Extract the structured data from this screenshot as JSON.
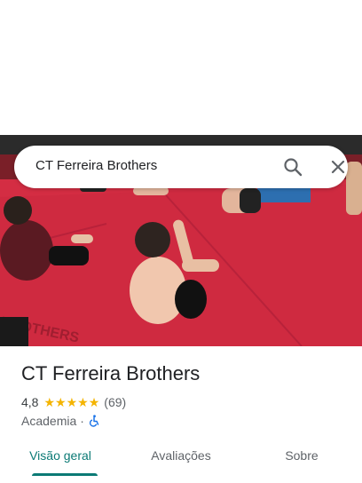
{
  "search": {
    "query": "CT Ferreira Brothers",
    "search_icon": "search-icon",
    "close_icon": "close-icon"
  },
  "place": {
    "name": "CT Ferreira Brothers",
    "rating": "4,8",
    "stars": 5,
    "review_count": "(69)",
    "category": "Academia",
    "separator": "·",
    "accessibility_icon": "wheelchair-icon"
  },
  "tabs": [
    {
      "label": "Visão geral",
      "active": true
    },
    {
      "label": "Avaliações",
      "active": false
    },
    {
      "label": "Sobre",
      "active": false
    }
  ],
  "colors": {
    "star": "#f4b400",
    "active_tab": "#0b7a75",
    "mat": "#c4253a",
    "accessibility": "#1a73e8"
  }
}
